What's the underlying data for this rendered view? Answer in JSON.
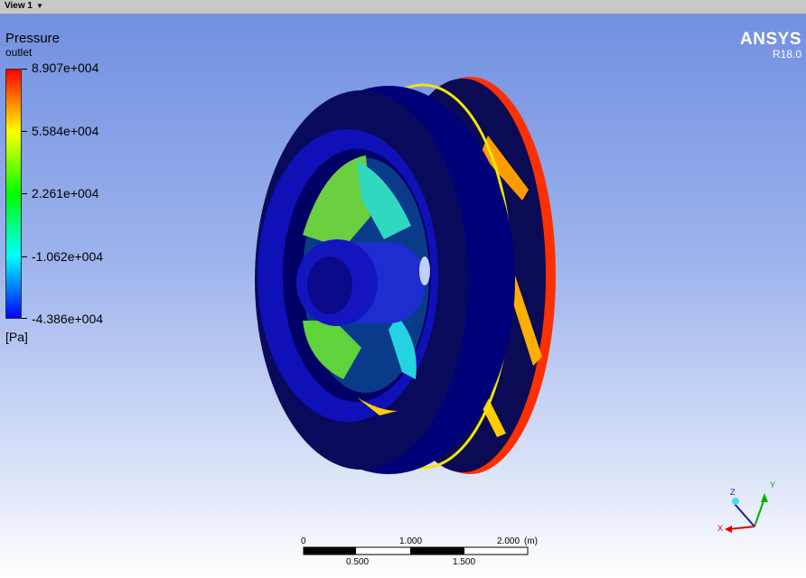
{
  "toolbar": {
    "view_label": "View 1"
  },
  "legend": {
    "title": "Pressure",
    "subtitle": "outlet",
    "units": "[Pa]",
    "ticks": [
      "8.907e+004",
      "5.584e+004",
      "2.261e+004",
      "-1.062e+004",
      "-4.386e+004"
    ],
    "colors": [
      "#ff0000",
      "#ffff00",
      "#00ff00",
      "#00ffff",
      "#0000ff"
    ]
  },
  "brand": {
    "name": "ANSYS",
    "version": "R18.0"
  },
  "scale": {
    "top": [
      "0",
      "1.000",
      "2.000",
      "(m)"
    ],
    "bottom": [
      "0.500",
      "1.500"
    ]
  },
  "triad": {
    "x": "X",
    "y": "Y",
    "z": "Z"
  }
}
